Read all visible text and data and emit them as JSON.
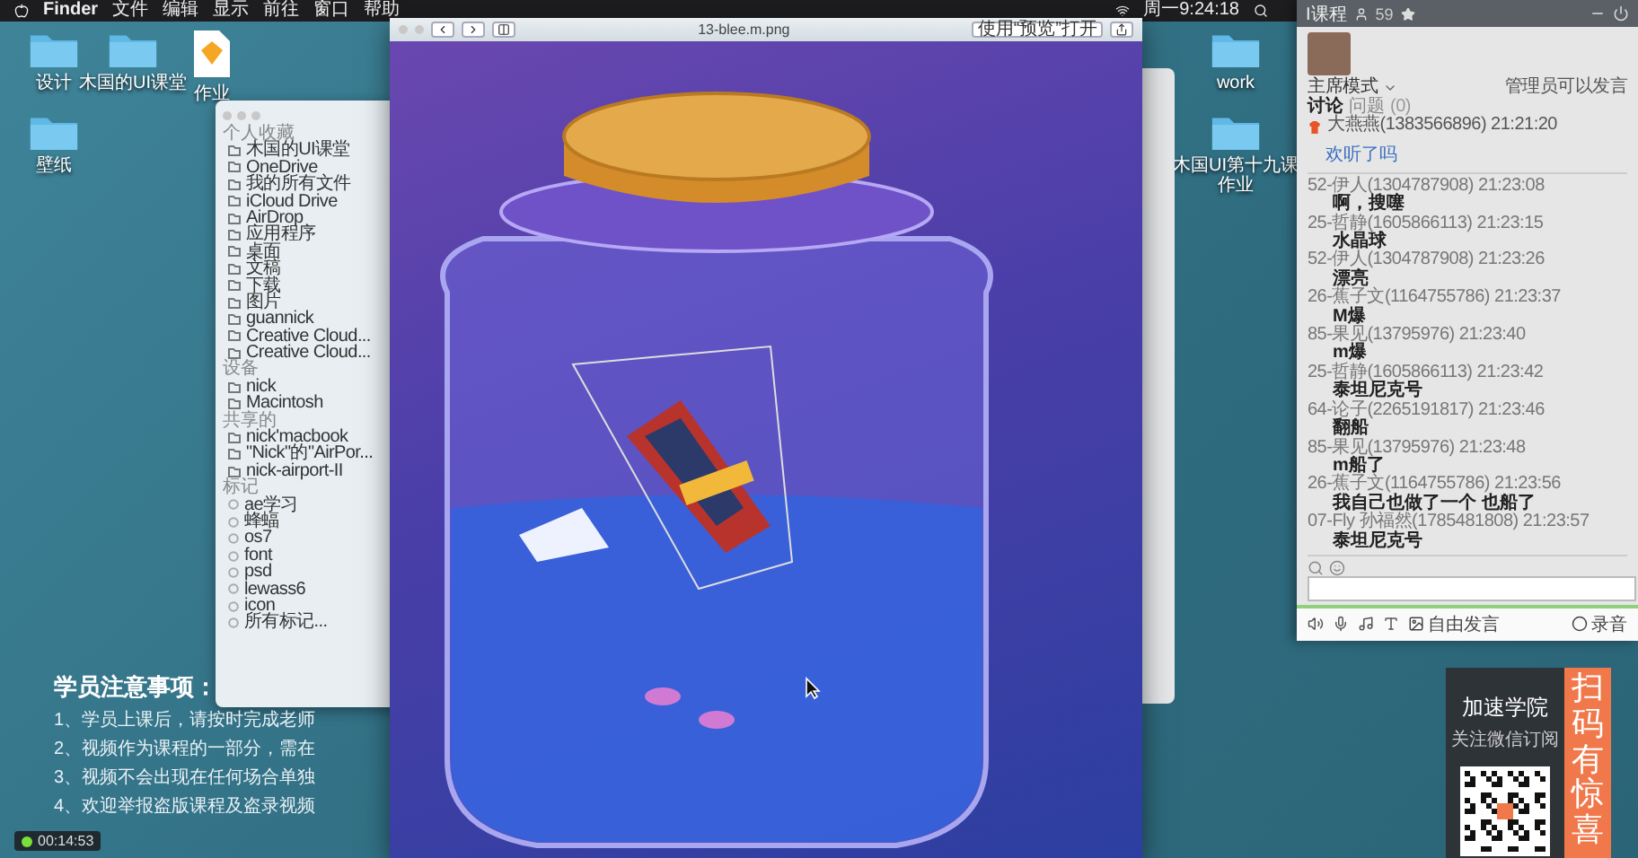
{
  "menubar": {
    "app": "Finder",
    "menus": [
      "文件",
      "编辑",
      "显示",
      "前往",
      "窗口",
      "帮助"
    ],
    "clock": "周一9:24:18"
  },
  "desktop_icons_left": [
    {
      "label": "设计",
      "kind": "folder"
    },
    {
      "label": "木国的UI课堂",
      "kind": "folder"
    },
    {
      "label": "作业",
      "kind": "sketch"
    },
    {
      "label": "壁纸",
      "kind": "folder"
    }
  ],
  "desktop_icons_right": [
    {
      "label": "work",
      "kind": "folder"
    },
    {
      "label": "木国UI第十九课作业",
      "kind": "folder"
    }
  ],
  "finder": {
    "sections": [
      {
        "title": "个人收藏",
        "kind": "places",
        "items": [
          "木国的UI课堂",
          "OneDrive",
          "我的所有文件",
          "iCloud Drive",
          "AirDrop",
          "应用程序",
          "桌面",
          "文稿",
          "下载",
          "图片",
          "guannick",
          "Creative Cloud...",
          "Creative Cloud..."
        ]
      },
      {
        "title": "设备",
        "kind": "places",
        "items": [
          "nick",
          "Macintosh"
        ]
      },
      {
        "title": "共享的",
        "kind": "places",
        "items": [
          "nick'macbook",
          "\"Nick\"的\"AirPor...",
          "nick-airport-II"
        ]
      },
      {
        "title": "标记",
        "kind": "tags",
        "items": [
          "ae学习",
          "蜂蝠",
          "os7",
          "font",
          "psd",
          "lewass6",
          "icon",
          "所有标记..."
        ]
      }
    ]
  },
  "preview": {
    "title": "13-blee.m.png",
    "open_button": "使用“预览”打开"
  },
  "chat": {
    "title": "I课程",
    "count": "59",
    "mode": "主席模式",
    "permission": "管理员可以发言",
    "tabs": [
      {
        "label": "讨论",
        "selected": true
      },
      {
        "label": "问题",
        "selected": false
      }
    ],
    "question_count": "(0)",
    "pinned": {
      "author": "大燕燕(1383566896) 21:21:20",
      "link": "欢听了吗"
    },
    "messages": [
      {
        "author": "52-伊人(1304787908) 21:23:08",
        "text": "啊，搜噻"
      },
      {
        "author": "25-哲静(1605866113) 21:23:15",
        "text": "水晶球"
      },
      {
        "author": "52-伊人(1304787908) 21:23:26",
        "text": "漂亮"
      },
      {
        "author": "26-蕉子文(1164755786) 21:23:37",
        "text": "M爆"
      },
      {
        "author": "85-果见(13795976) 21:23:40",
        "text": "m爆"
      },
      {
        "author": "25-哲静(1605866113) 21:23:42",
        "text": "泰坦尼克号"
      },
      {
        "author": "64-论子(2265191817) 21:23:46",
        "text": "翻船"
      },
      {
        "author": "85-果见(13795976) 21:23:48",
        "text": "m船了"
      },
      {
        "author": "26-蕉子文(1164755786) 21:23:56",
        "text": "我自己也做了一个 也船了"
      },
      {
        "author": "07-Fly 孙福然(1785481808) 21:23:57",
        "text": "泰坦尼克号"
      }
    ],
    "toolbar_labels": [
      "自由发言",
      "录音"
    ]
  },
  "notes": {
    "title": "学员注意事项：",
    "lines": [
      "1、学员上课后，请按时完成老师",
      "2、视频作为课程的一部分，需在",
      "3、视频不会出现在任何场合单独",
      "4、欢迎举报盗版课程及盗录视频"
    ]
  },
  "timer": "00:14:53",
  "promo": {
    "title": "加速学院",
    "subtitle": "关注微信订阅",
    "call_to_action": "扫码有惊喜"
  }
}
